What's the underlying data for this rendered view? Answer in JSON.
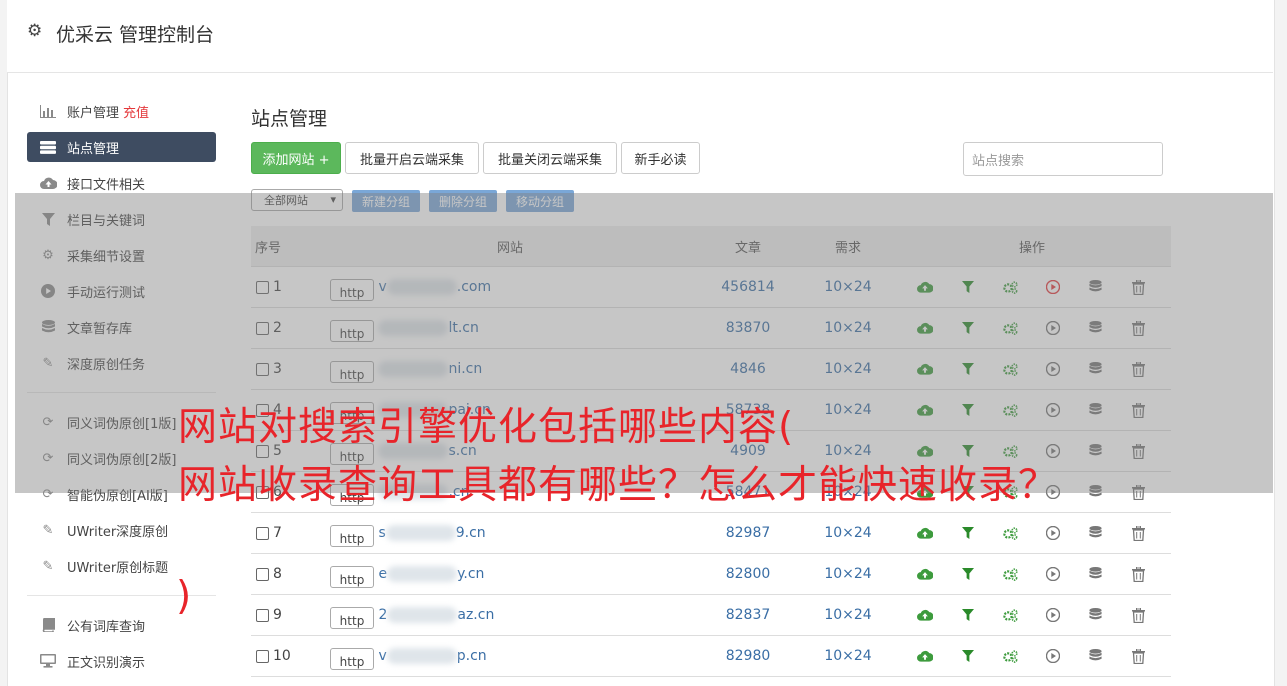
{
  "header": {
    "title": "优采云 管理控制台"
  },
  "sidebar": {
    "items": [
      {
        "label": "账户管理",
        "extra": "充值",
        "icon": "bar-chart-icon"
      },
      {
        "label": "站点管理",
        "icon": "server-icon",
        "active": true
      },
      {
        "label": "接口文件相关",
        "icon": "cloud-upload-icon"
      },
      {
        "label": "栏目与关键词",
        "icon": "filter-icon"
      },
      {
        "label": "采集细节设置",
        "icon": "gears-icon"
      },
      {
        "label": "手动运行测试",
        "icon": "play-circle-icon"
      },
      {
        "label": "文章暂存库",
        "icon": "database-icon"
      },
      {
        "label": "深度原创任务",
        "icon": "edit-icon"
      },
      {
        "label": "同义词伪原创[1版]",
        "icon": "refresh-icon"
      },
      {
        "label": "同义词伪原创[2版]",
        "icon": "refresh-icon"
      },
      {
        "label": "智能伪原创[AI版]",
        "icon": "refresh-icon"
      },
      {
        "label": "UWriter深度原创",
        "icon": "edit-icon"
      },
      {
        "label": "UWriter原创标题",
        "icon": "edit-icon"
      },
      {
        "label": "公有词库查询",
        "icon": "book-icon"
      },
      {
        "label": "正文识别演示",
        "icon": "monitor-icon"
      }
    ]
  },
  "main": {
    "title": "站点管理",
    "buttons": {
      "add": "添加网站 +",
      "batch_open": "批量开启云端采集",
      "batch_close": "批量关闭云端采集",
      "guide": "新手必读"
    },
    "search_placeholder": "站点搜索",
    "group_select": "全部网站",
    "group_buttons": {
      "new": "新建分组",
      "delete": "删除分组",
      "move": "移动分组"
    },
    "table": {
      "headers": [
        "序号",
        "网站",
        "文章",
        "需求",
        "操作"
      ],
      "http_label": "http",
      "rows": [
        {
          "no": "1",
          "prefix": "v",
          "suffix": ".com",
          "articles": "456814",
          "demand": "10×24",
          "running": true
        },
        {
          "no": "2",
          "prefix": "",
          "suffix": "lt.cn",
          "articles": "83870",
          "demand": "10×24"
        },
        {
          "no": "3",
          "prefix": "",
          "suffix": "ni.cn",
          "articles": "4846",
          "demand": "10×24"
        },
        {
          "no": "4",
          "prefix": "",
          "suffix": "pai.cn",
          "articles": "58738",
          "demand": "10×24"
        },
        {
          "no": "5",
          "prefix": "",
          "suffix": "s.cn",
          "articles": "4909",
          "demand": "10×24"
        },
        {
          "no": "6",
          "prefix": "",
          "suffix": ".cn",
          "articles": "58471",
          "demand": "10×24"
        },
        {
          "no": "7",
          "prefix": "s",
          "suffix": "9.cn",
          "articles": "82987",
          "demand": "10×24"
        },
        {
          "no": "8",
          "prefix": "e",
          "suffix": "y.cn",
          "articles": "82800",
          "demand": "10×24"
        },
        {
          "no": "9",
          "prefix": "2",
          "suffix": "az.cn",
          "articles": "82837",
          "demand": "10×24"
        },
        {
          "no": "10",
          "prefix": "v",
          "suffix": "p.cn",
          "articles": "82980",
          "demand": "10×24"
        }
      ]
    }
  },
  "watermark": {
    "line1": "网站对搜索引擎优化包括哪些内容(",
    "line2": "网站收录查询工具都有哪些？怎么才能快速收录？",
    "line3": ")"
  },
  "colors": {
    "accent_green": "#5cb85c",
    "sidebar_active": "#3e4c61",
    "link_blue": "#3a6ea5",
    "watermark_red": "#e8242a"
  }
}
